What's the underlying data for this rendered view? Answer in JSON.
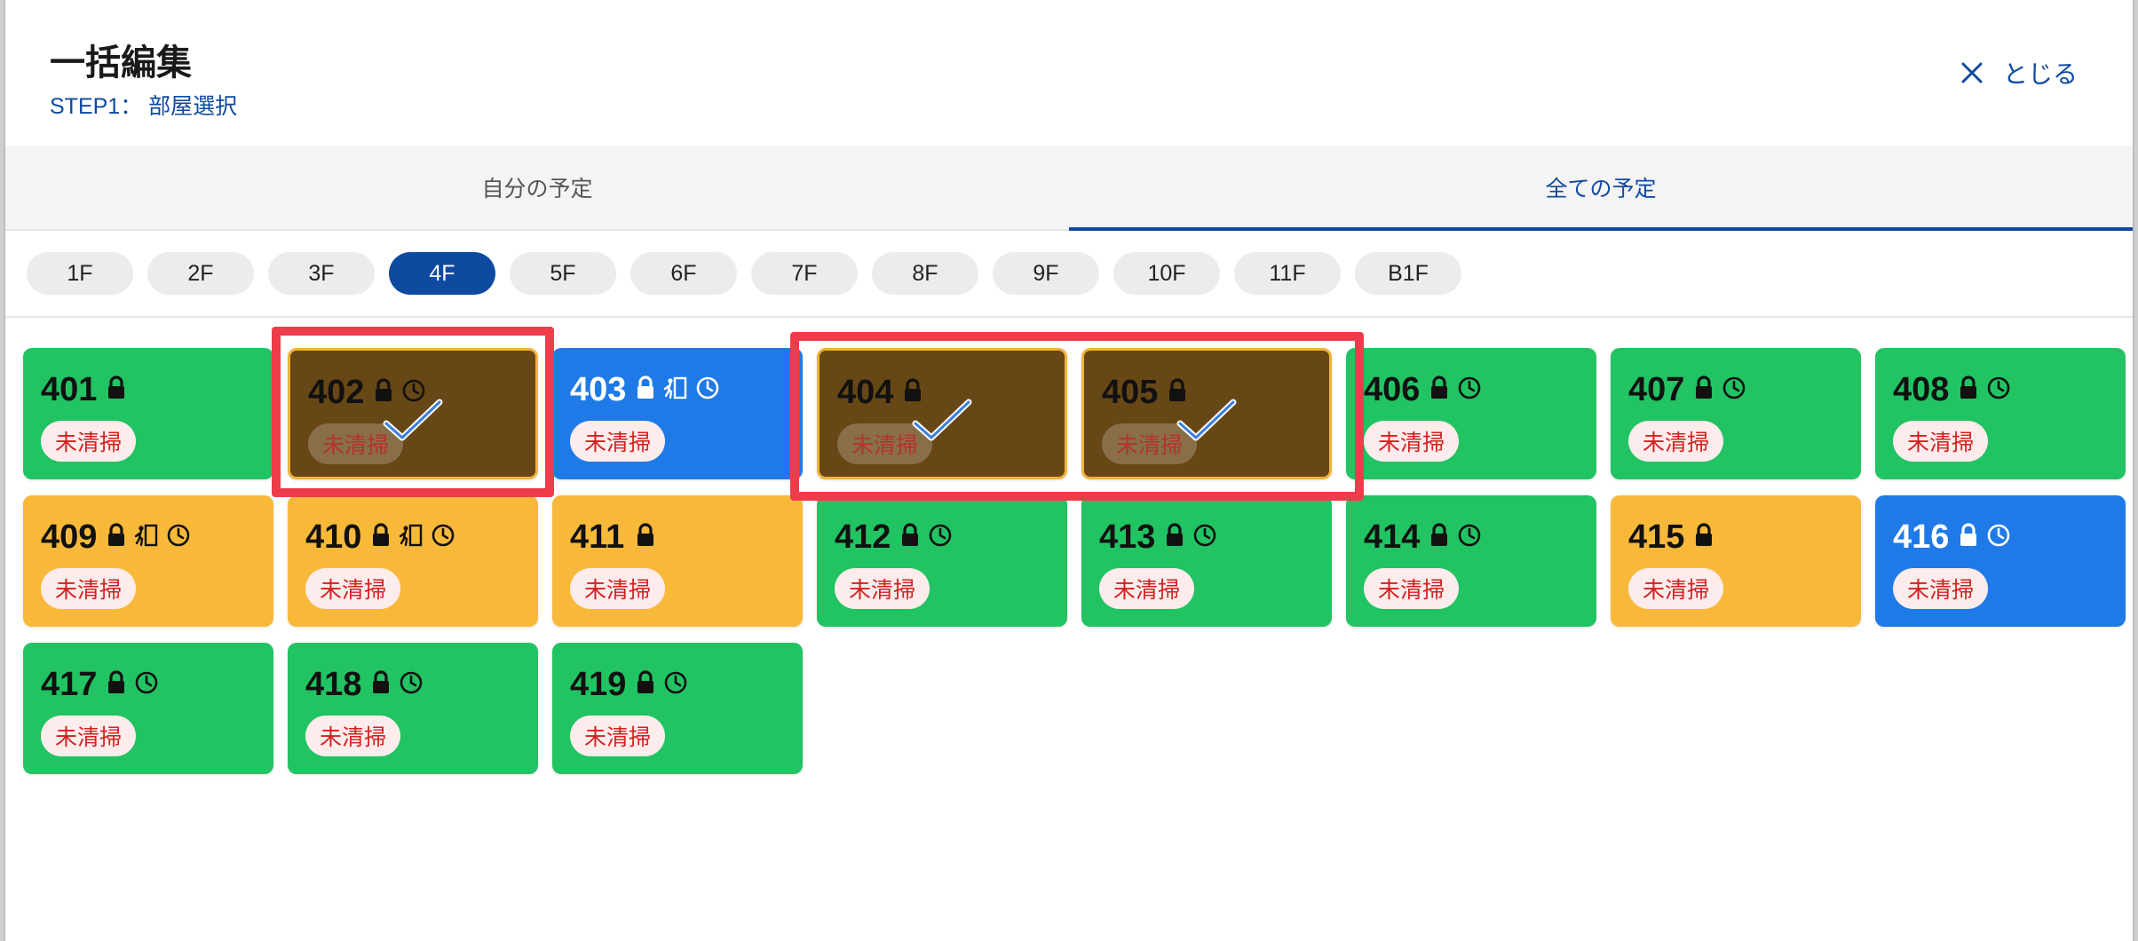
{
  "header": {
    "title": "一括編集",
    "step": "STEP1： 部屋選択",
    "close_label": "とじる"
  },
  "tabs": [
    {
      "label": "自分の予定",
      "active": false
    },
    {
      "label": "全ての予定",
      "active": true
    }
  ],
  "floors": [
    "1F",
    "2F",
    "3F",
    "4F",
    "5F",
    "6F",
    "7F",
    "8F",
    "9F",
    "10F",
    "11F",
    "B1F"
  ],
  "active_floor": "4F",
  "status_label": "未清掃",
  "rooms": [
    {
      "number": "401",
      "color": "green",
      "icons": [
        "lock"
      ],
      "selected": false
    },
    {
      "number": "402",
      "color": "green",
      "icons": [
        "lock",
        "clock"
      ],
      "selected": true
    },
    {
      "number": "403",
      "color": "blue",
      "icons": [
        "lock",
        "exit",
        "clock"
      ],
      "selected": false
    },
    {
      "number": "404",
      "color": "green",
      "icons": [
        "lock"
      ],
      "selected": true
    },
    {
      "number": "405",
      "color": "green",
      "icons": [
        "lock"
      ],
      "selected": true
    },
    {
      "number": "406",
      "color": "green",
      "icons": [
        "lock",
        "clock"
      ],
      "selected": false
    },
    {
      "number": "407",
      "color": "green",
      "icons": [
        "lock",
        "clock"
      ],
      "selected": false
    },
    {
      "number": "408",
      "color": "green",
      "icons": [
        "lock",
        "clock"
      ],
      "selected": false
    },
    {
      "number": "409",
      "color": "orange",
      "icons": [
        "lock",
        "exit",
        "clock"
      ],
      "selected": false
    },
    {
      "number": "410",
      "color": "orange",
      "icons": [
        "lock",
        "exit",
        "clock"
      ],
      "selected": false
    },
    {
      "number": "411",
      "color": "orange",
      "icons": [
        "lock"
      ],
      "selected": false
    },
    {
      "number": "412",
      "color": "green",
      "icons": [
        "lock",
        "clock"
      ],
      "selected": false
    },
    {
      "number": "413",
      "color": "green",
      "icons": [
        "lock",
        "clock"
      ],
      "selected": false
    },
    {
      "number": "414",
      "color": "green",
      "icons": [
        "lock",
        "clock"
      ],
      "selected": false
    },
    {
      "number": "415",
      "color": "orange",
      "icons": [
        "lock"
      ],
      "selected": false
    },
    {
      "number": "416",
      "color": "blue",
      "icons": [
        "lock",
        "clock"
      ],
      "selected": false
    },
    {
      "number": "417",
      "color": "green",
      "icons": [
        "lock",
        "clock"
      ],
      "selected": false
    },
    {
      "number": "418",
      "color": "green",
      "icons": [
        "lock",
        "clock"
      ],
      "selected": false
    },
    {
      "number": "419",
      "color": "green",
      "icons": [
        "lock",
        "clock"
      ],
      "selected": false
    }
  ],
  "colors": {
    "accent": "#0f4aa1",
    "green": "#22c362",
    "orange": "#f8b93b",
    "blue": "#1f7ae8",
    "selected": "#674715",
    "highlight": "#ee3c4b"
  }
}
